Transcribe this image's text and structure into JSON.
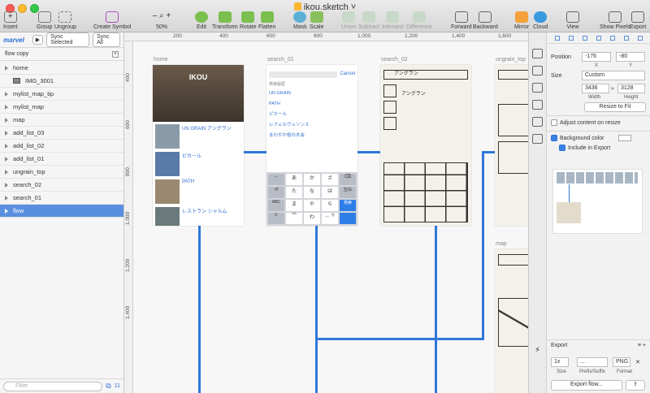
{
  "window": {
    "title": "ikou.sketch"
  },
  "toolbar": {
    "insert": "Insert",
    "group": "Group",
    "ungroup": "Ungroup",
    "create_symbol": "Create Symbol",
    "zoom": "50%",
    "edit": "Edit",
    "transform": "Transform",
    "rotate": "Rotate",
    "flatten": "Flatten",
    "mask": "Mask",
    "scale": "Scale",
    "union": "Union",
    "subtract": "Subtract",
    "intersect": "Intersect",
    "difference": "Difference",
    "forward": "Forward",
    "backward": "Backward",
    "mirror": "Mirror",
    "cloud": "Cloud",
    "view": "View",
    "show_pixels": "Show Pixels",
    "export": "Export"
  },
  "sidebar": {
    "brand": "marvel",
    "play_label": "▶",
    "sync_selected": "Sync Selected",
    "sync_all": "Sync All",
    "page": "flow copy",
    "page_add": "+",
    "layers": [
      {
        "label": "home"
      },
      {
        "label": "IMG_3001"
      },
      {
        "label": "mylist_map_tip"
      },
      {
        "label": "mylist_map"
      },
      {
        "label": "map"
      },
      {
        "label": "add_list_03"
      },
      {
        "label": "add_list_02"
      },
      {
        "label": "add_list_01"
      },
      {
        "label": "ungrain_top"
      },
      {
        "label": "search_02"
      },
      {
        "label": "search_01"
      },
      {
        "label": "flow"
      }
    ],
    "filter_placeholder": "Filter",
    "count": "11"
  },
  "canvas": {
    "ruler_top": [
      "200",
      "400",
      "600",
      "800",
      "1,000",
      "1,200",
      "1,400",
      "1,600",
      "1,800"
    ],
    "ruler_left": [
      "400",
      "600",
      "800",
      "1,000",
      "1,200",
      "1,400"
    ],
    "artboards": {
      "home": "home",
      "search_01": "search_01",
      "search_02": "search_02",
      "ungrain_top": "ungrain_top",
      "map": "map"
    },
    "home_screen": {
      "logo": "IKOU",
      "items": [
        {
          "title": "UN GRAIN アングラン"
        },
        {
          "title": "ピカール"
        },
        {
          "title": "PATH"
        },
        {
          "title": "レストラン シャルム"
        }
      ]
    },
    "search_screen": {
      "cancel": "Cancel",
      "section": "検索履歴",
      "results": [
        "UN GRAIN",
        "PATH",
        "ピカール",
        "レフェルヴェソンス",
        "まわやか桜の木会"
      ],
      "keys": [
        "→",
        "あ",
        "か",
        "さ",
        "⌫",
        "↺",
        "た",
        "な",
        "は",
        "空白",
        "ABC",
        "ま",
        "や",
        "ら",
        "検索",
        "☺",
        "^^",
        "わ",
        "、。?!"
      ]
    },
    "sketch_search_text": "アングラン",
    "sketch_list_items": [
      "アングラン",
      "アングラン",
      "アングラン"
    ]
  },
  "inspector": {
    "position_label": "Position",
    "x": "-176",
    "y": "-80",
    "x_label": "X",
    "y_label": "Y",
    "size_label": "Size",
    "size_preset": "Custom",
    "width": "3436",
    "height": "3128",
    "width_label": "Width",
    "height_label": "Height",
    "resize_to_fit": "Resize to Fit",
    "adjust_content": "Adjust content on resize",
    "background_color": "Background color",
    "include_in_export": "Include in Export",
    "export_title": "Export",
    "export_scale": "1x",
    "export_prefix": "...",
    "export_format": "PNG",
    "size_col": "Size",
    "prefix_col": "Prefix/Suffix",
    "format_col": "Format",
    "export_button": "Export flow..."
  },
  "colors": {
    "selection": "#5a8fe0",
    "flow_line": "#2f78d8"
  }
}
